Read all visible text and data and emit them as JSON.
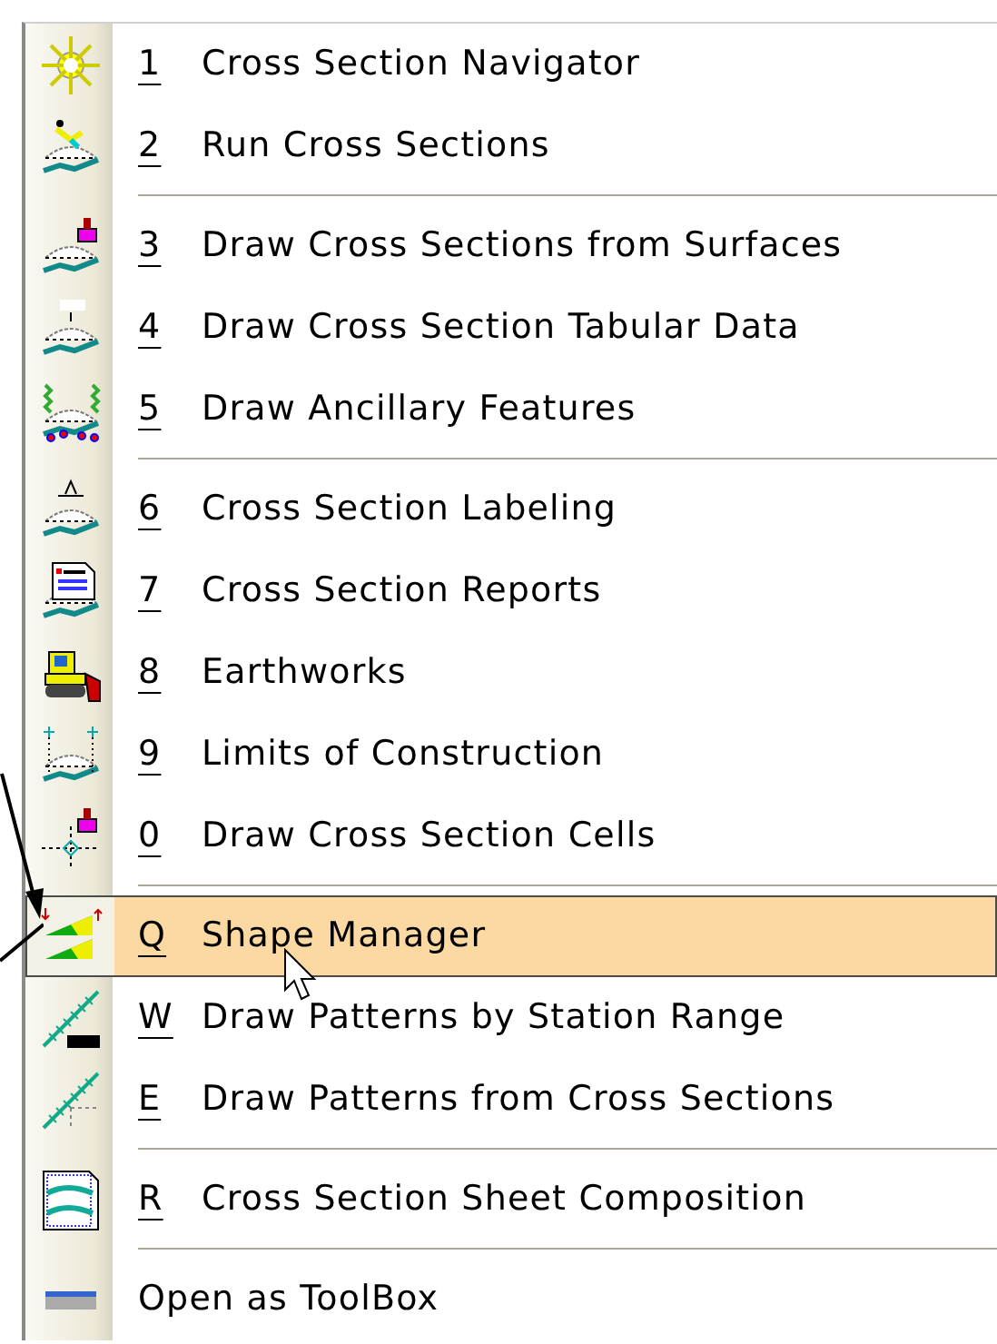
{
  "menu": {
    "items": [
      {
        "kind": "item",
        "key": "1",
        "label": "Cross Section Navigator",
        "selected": false
      },
      {
        "kind": "item",
        "key": "2",
        "label": "Run Cross Sections",
        "selected": false
      },
      {
        "kind": "separator"
      },
      {
        "kind": "item",
        "key": "3",
        "label": "Draw Cross Sections from Surfaces",
        "selected": false
      },
      {
        "kind": "item",
        "key": "4",
        "label": "Draw Cross Section Tabular Data",
        "selected": false
      },
      {
        "kind": "item",
        "key": "5",
        "label": "Draw Ancillary Features",
        "selected": false
      },
      {
        "kind": "separator"
      },
      {
        "kind": "item",
        "key": "6",
        "label": "Cross Section Labeling",
        "selected": false
      },
      {
        "kind": "item",
        "key": "7",
        "label": "Cross Section Reports",
        "selected": false
      },
      {
        "kind": "item",
        "key": "8",
        "label": "Earthworks",
        "selected": false
      },
      {
        "kind": "item",
        "key": "9",
        "label": "Limits of Construction",
        "selected": false
      },
      {
        "kind": "item",
        "key": "0",
        "label": "Draw Cross Section Cells",
        "selected": false
      },
      {
        "kind": "separator"
      },
      {
        "kind": "item",
        "key": "Q",
        "label": "Shape Manager",
        "selected": true
      },
      {
        "kind": "item",
        "key": "W",
        "label": "Draw Patterns by Station Range",
        "selected": false
      },
      {
        "kind": "item",
        "key": "E",
        "label": "Draw Patterns from Cross Sections",
        "selected": false
      },
      {
        "kind": "separator"
      },
      {
        "kind": "item",
        "key": "R",
        "label": "Cross Section Sheet Composition",
        "selected": false
      },
      {
        "kind": "separator"
      },
      {
        "kind": "item",
        "label": "Open as ToolBox",
        "selected": false
      }
    ]
  }
}
